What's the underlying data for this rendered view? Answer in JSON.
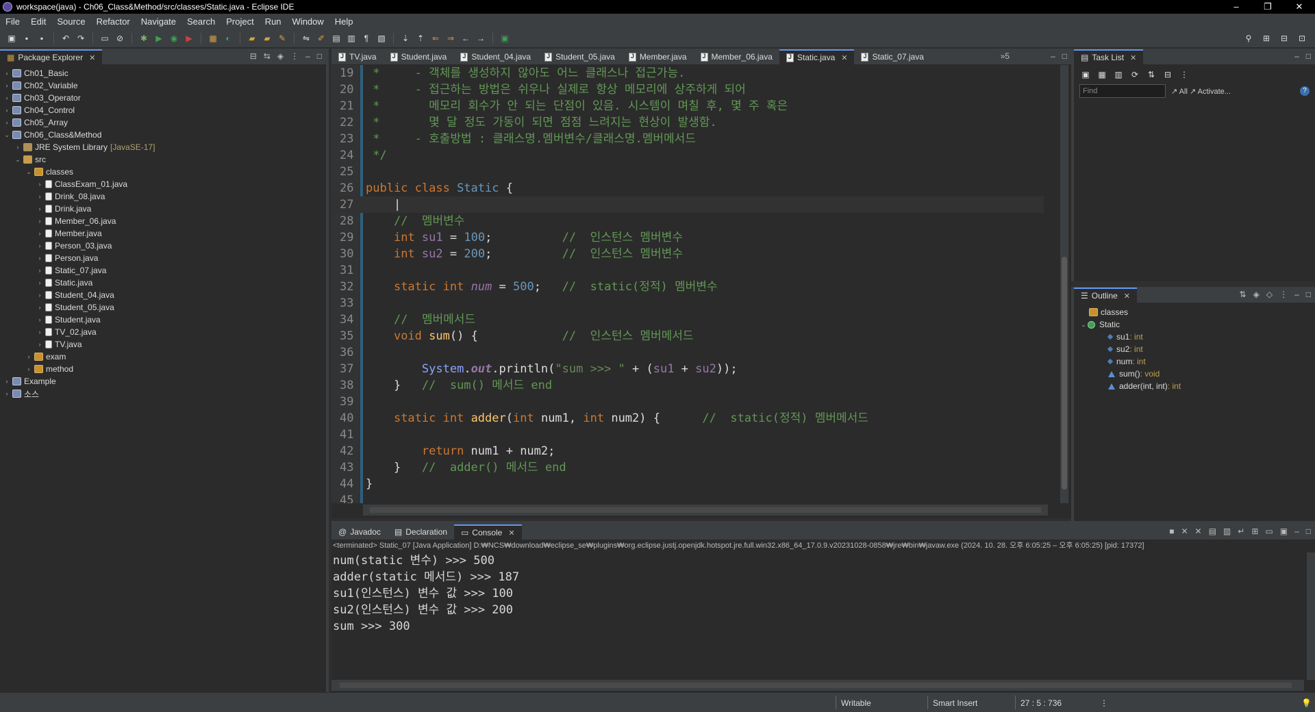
{
  "window": {
    "title": "workspace(java) - Ch06_Class&Method/src/classes/Static.java - Eclipse IDE",
    "controls": [
      "–",
      "❐",
      "✕"
    ]
  },
  "menu": [
    "File",
    "Edit",
    "Source",
    "Refactor",
    "Navigate",
    "Search",
    "Project",
    "Run",
    "Window",
    "Help"
  ],
  "package_explorer": {
    "title": "Package Explorer",
    "tree": [
      {
        "label": "Ch01_Basic",
        "indent": 0,
        "twisty": "›",
        "icon": "proj"
      },
      {
        "label": "Ch02_Variable",
        "indent": 0,
        "twisty": "›",
        "icon": "proj"
      },
      {
        "label": "Ch03_Operator",
        "indent": 0,
        "twisty": "›",
        "icon": "proj"
      },
      {
        "label": "Ch04_Control",
        "indent": 0,
        "twisty": "›",
        "icon": "proj"
      },
      {
        "label": "Ch05_Array",
        "indent": 0,
        "twisty": "›",
        "icon": "proj"
      },
      {
        "label": "Ch06_Class&Method",
        "indent": 0,
        "twisty": "⌄",
        "icon": "proj"
      },
      {
        "label": "JRE System Library",
        "suffix": "[JavaSE-17]",
        "indent": 1,
        "twisty": "›",
        "icon": "lib"
      },
      {
        "label": "src",
        "indent": 1,
        "twisty": "⌄",
        "icon": "src"
      },
      {
        "label": "classes",
        "indent": 2,
        "twisty": "⌄",
        "icon": "pkg"
      },
      {
        "label": "ClassExam_01.java",
        "indent": 3,
        "twisty": "›",
        "icon": "file"
      },
      {
        "label": "Drink_08.java",
        "indent": 3,
        "twisty": "›",
        "icon": "file"
      },
      {
        "label": "Drink.java",
        "indent": 3,
        "twisty": "›",
        "icon": "file"
      },
      {
        "label": "Member_06.java",
        "indent": 3,
        "twisty": "›",
        "icon": "file"
      },
      {
        "label": "Member.java",
        "indent": 3,
        "twisty": "›",
        "icon": "file"
      },
      {
        "label": "Person_03.java",
        "indent": 3,
        "twisty": "›",
        "icon": "file"
      },
      {
        "label": "Person.java",
        "indent": 3,
        "twisty": "›",
        "icon": "file"
      },
      {
        "label": "Static_07.java",
        "indent": 3,
        "twisty": "›",
        "icon": "file"
      },
      {
        "label": "Static.java",
        "indent": 3,
        "twisty": "›",
        "icon": "file"
      },
      {
        "label": "Student_04.java",
        "indent": 3,
        "twisty": "›",
        "icon": "file"
      },
      {
        "label": "Student_05.java",
        "indent": 3,
        "twisty": "›",
        "icon": "file"
      },
      {
        "label": "Student.java",
        "indent": 3,
        "twisty": "›",
        "icon": "file"
      },
      {
        "label": "TV_02.java",
        "indent": 3,
        "twisty": "›",
        "icon": "file"
      },
      {
        "label": "TV.java",
        "indent": 3,
        "twisty": "›",
        "icon": "file"
      },
      {
        "label": "exam",
        "indent": 2,
        "twisty": "›",
        "icon": "pkg"
      },
      {
        "label": "method",
        "indent": 2,
        "twisty": "›",
        "icon": "pkg"
      },
      {
        "label": "Example",
        "indent": 0,
        "twisty": "›",
        "icon": "proj"
      },
      {
        "label": "소스",
        "indent": 0,
        "twisty": "›",
        "icon": "proj"
      }
    ]
  },
  "editor": {
    "tabs": [
      {
        "label": "TV.java",
        "active": false
      },
      {
        "label": "Student.java",
        "active": false
      },
      {
        "label": "Student_04.java",
        "active": false
      },
      {
        "label": "Student_05.java",
        "active": false
      },
      {
        "label": "Member.java",
        "active": false
      },
      {
        "label": "Member_06.java",
        "active": false
      },
      {
        "label": "Static.java",
        "active": true
      },
      {
        "label": "Static_07.java",
        "active": false
      }
    ],
    "overflow": "»5",
    "current_line": 27,
    "lines": [
      {
        "n": "19",
        "html": "<span class='cm'> *     - 객체를 생성하지 않아도 어느 클래스나 접근가능.</span>"
      },
      {
        "n": "20",
        "html": "<span class='cm'> *     - 접근하는 방법은 쉬우나 실제로 항상 메모리에 상주하게 되어</span>"
      },
      {
        "n": "21",
        "html": "<span class='cm'> *       메모리 회수가 안 되는 단점이 있음. 시스템이 며칠 후, 몇 주 혹은</span>"
      },
      {
        "n": "22",
        "html": "<span class='cm'> *       몇 달 정도 가동이 되면 점점 느려지는 현상이 발생함.</span>"
      },
      {
        "n": "23",
        "html": "<span class='cm'> *     - 호출방법 : 클래스명.멤버변수/클래스명.멤버메서드</span>"
      },
      {
        "n": "24",
        "html": "<span class='cm'> */</span>"
      },
      {
        "n": "25",
        "html": ""
      },
      {
        "n": "26",
        "html": "<span class='kw'>public class</span> <span class='cls'>Static</span> {"
      },
      {
        "n": "27",
        "html": "    |"
      },
      {
        "n": "28",
        "html": "    <span class='cm'>//  멤버변수</span>"
      },
      {
        "n": "29",
        "html": "    <span class='kw'>int</span> <span class='fld'>su1</span> = <span class='num'>100</span>;          <span class='cm'>//  인스턴스 멤버변수</span>"
      },
      {
        "n": "30",
        "html": "    <span class='kw'>int</span> <span class='fld'>su2</span> = <span class='num'>200</span>;          <span class='cm'>//  인스턴스 멤버변수</span>"
      },
      {
        "n": "31",
        "html": ""
      },
      {
        "n": "32",
        "html": "    <span class='kw'>static int</span> <span class='stf'>num</span> = <span class='num'>500</span>;   <span class='cm'>//  static(정적) 멤버변수</span>"
      },
      {
        "n": "33",
        "html": ""
      },
      {
        "n": "34",
        "html": "    <span class='cm'>//  멤버메서드</span>"
      },
      {
        "n": "35",
        "html": "    <span class='kw'>void</span> <span class='mth'>sum</span>() {            <span class='cm'>//  인스턴스 멤버메서드</span>"
      },
      {
        "n": "36",
        "html": ""
      },
      {
        "n": "37",
        "html": "        <span class='sys'>System</span>.<span class='out'>out</span>.println(<span class='str'>\"sum >>> \"</span> + (<span class='fld'>su1</span> + <span class='fld'>su2</span>));"
      },
      {
        "n": "38",
        "html": "    }   <span class='cm'>//  sum() 메서드 end</span>"
      },
      {
        "n": "39",
        "html": ""
      },
      {
        "n": "40",
        "html": "    <span class='kw'>static int</span> <span class='mth'>adder</span>(<span class='kw'>int</span> num1, <span class='kw'>int</span> num2) {      <span class='cm'>//  static(정적) 멤버메서드</span>"
      },
      {
        "n": "41",
        "html": ""
      },
      {
        "n": "42",
        "html": "        <span class='kw'>return</span> num1 + num2;"
      },
      {
        "n": "43",
        "html": "    }   <span class='cm'>//  adder() 메서드 end</span>"
      },
      {
        "n": "44",
        "html": "}"
      },
      {
        "n": "45",
        "html": ""
      }
    ]
  },
  "task_list": {
    "title": "Task List",
    "find_placeholder": "Find",
    "links": "↗ All   ↗ Activate..."
  },
  "outline": {
    "title": "Outline",
    "items": [
      {
        "label": "classes",
        "type": "",
        "kind": "pkg",
        "indent": 0,
        "twisty": ""
      },
      {
        "label": "Static",
        "type": "",
        "kind": "class",
        "indent": 0,
        "twisty": "⌄"
      },
      {
        "label": "su1",
        "type": " : int",
        "kind": "field",
        "indent": 1,
        "twisty": ""
      },
      {
        "label": "su2",
        "type": " : int",
        "kind": "field",
        "indent": 1,
        "twisty": ""
      },
      {
        "label": "num",
        "type": " : int",
        "kind": "sfield",
        "indent": 1,
        "twisty": ""
      },
      {
        "label": "sum()",
        "type": " : void",
        "kind": "method",
        "indent": 1,
        "twisty": ""
      },
      {
        "label": "adder(int, int)",
        "type": " : int",
        "kind": "smethod",
        "indent": 1,
        "twisty": ""
      }
    ]
  },
  "console": {
    "tabs": [
      {
        "label": "Javadoc",
        "active": false
      },
      {
        "label": "Declaration",
        "active": false
      },
      {
        "label": "Console",
        "active": true
      }
    ],
    "info": "<terminated> Static_07 [Java Application] D:₩NCS₩download₩eclipse_se₩plugins₩org.eclipse.justj.openjdk.hotspot.jre.full.win32.x86_64_17.0.9.v20231028-0858₩jre₩bin₩javaw.exe  (2024. 10. 28. 오후 6:05:25 – 오후 6:05:25) [pid: 17372]",
    "output": [
      "num(static 변수) >>> 500",
      "adder(static 메서드) >>> 187",
      "su1(인스턴스) 변수 값 >>> 100",
      "su2(인스턴스) 변수 값 >>> 200",
      "sum >>> 300"
    ]
  },
  "status": {
    "writable": "Writable",
    "insert_mode": "Smart Insert",
    "position": "27 : 5 : 736"
  }
}
